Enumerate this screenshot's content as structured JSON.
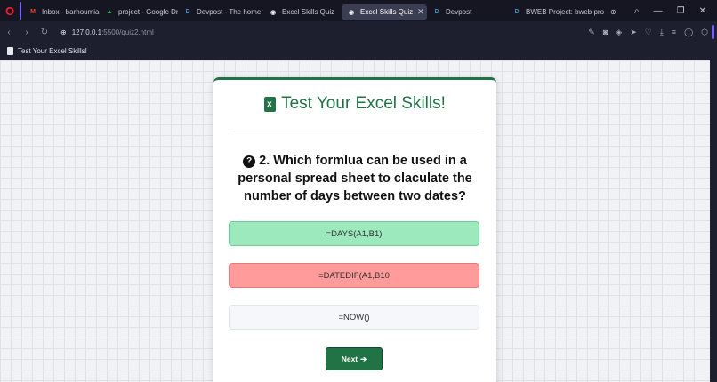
{
  "browser": {
    "tabs": [
      {
        "label": "Inbox - barhoumiamina",
        "icon": "gmail-icon",
        "fav_text": "M",
        "color": "#ea4335",
        "active": false
      },
      {
        "label": "project - Google Drive",
        "icon": "google-drive-icon",
        "fav_text": "▲",
        "color": "#34a853",
        "active": false
      },
      {
        "label": "Devpost - The home fo",
        "icon": "devpost-icon",
        "fav_text": "D",
        "color": "#3a8cc6",
        "active": false
      },
      {
        "label": "Excel Skills Quiz",
        "icon": "globe-icon",
        "fav_text": "◉",
        "color": "#e8e8f0",
        "active": false
      },
      {
        "label": "Excel Skills Quiz",
        "icon": "globe-icon",
        "fav_text": "◉",
        "color": "#e8e8f0",
        "active": true
      },
      {
        "label": "Devpost",
        "icon": "devpost-icon",
        "fav_text": "D",
        "color": "#3a8cc6",
        "active": false
      },
      {
        "label": "BWEB Project: bweb pro",
        "icon": "devpost-icon",
        "fav_text": "D",
        "color": "#3a8cc6",
        "active": false
      }
    ],
    "url_host": "127.0.0.1",
    "url_rest": ":5500/quiz2.html",
    "bookmark": "Test Your Excel Skills!"
  },
  "quiz": {
    "title": "Test Your Excel Skills!",
    "question": "2. Which formlua can be used in a personal spread sheet to claculate the number of days between two dates?",
    "options": [
      "=DAYS(A1,B1)",
      "=DATEDIF(A1,B10",
      "=NOW()"
    ],
    "option_states": [
      "correct",
      "wrong",
      "neutral"
    ],
    "next_label": "Next",
    "next_arrow": "➔"
  },
  "colors": {
    "accent": "#217346",
    "correct": "#9ce9bd",
    "wrong": "#ff9b9b",
    "neutral": "#f5f7fa"
  }
}
